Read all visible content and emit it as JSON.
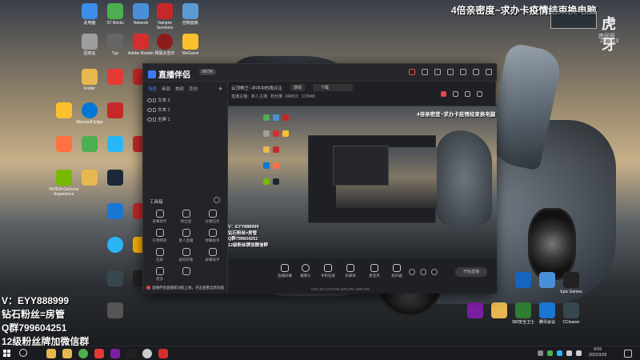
{
  "overlay": {
    "top_text": "4倍亲密度~求办卡疫情结束换电脑",
    "left_lines": [
      "V：EYY888999",
      "钻石粉丝=房管",
      "Q群799604251",
      "12级粉丝牌加微信群"
    ]
  },
  "badge": {
    "logo": "虎牙",
    "room_label": "房间号",
    "room_number": "249813"
  },
  "app": {
    "name": "直播伴侣",
    "version_label": "BETA",
    "left_tabs": [
      "场景",
      "画面",
      "美颜",
      "其他"
    ],
    "scenes": [
      "文本 2",
      "文本 1",
      "全屏 1"
    ],
    "tools_title": "工具箱",
    "tools": [
      "屏幕助手",
      "粉丝团",
      "主播任务",
      "礼物特效",
      "素人直播",
      "弹幕助手",
      "连屏",
      "虚拟形象",
      "屏幕助手",
      "更多",
      ""
    ],
    "notice": "直播伴侣直播新功能上线，点击查看全新功能",
    "room_title": "云顶棋王~冲冲冲的观点注",
    "category": "游戏",
    "game": "下载",
    "room_meta": "直播主播：新人主播",
    "stat_label1": "粉丝量",
    "stat_value1": "249813",
    "stat_value2": "172948",
    "bottom_items": [
      "直播屏幕",
      "摄像头",
      "手机投屏",
      "多媒体",
      "麦克风",
      "扬声器"
    ],
    "start_live_label": "开始直播",
    "status_text": "CPU:0%  CPU:0%  GPU:0%  GPU:0%"
  },
  "desktop_icons": [
    {
      "label": "此电脑",
      "color": "#3a8ee6"
    },
    {
      "label": "ST Bricks",
      "color": "#4caf50"
    },
    {
      "label": "Network",
      "color": "#4a90d9"
    },
    {
      "label": "Vampire Survivors",
      "color": "#c62828"
    },
    {
      "label": "控制面板",
      "color": "#5b9bd5"
    },
    {
      "label": "回收站",
      "color": "#9e9e9e"
    },
    {
      "label": "Typ",
      "color": "#666"
    },
    {
      "label": "Adobe Reader",
      "color": "#d32f2f"
    },
    {
      "label": "网易云音乐",
      "color": "#c62828"
    },
    {
      "label": "WeGame",
      "color": "#fbc02d"
    },
    {
      "label": "Microsoft Edge",
      "color": "#0078d4"
    },
    {
      "label": "Chrome",
      "color": "#4caf50"
    },
    {
      "label": "Firefox",
      "color": "#ff7043"
    },
    {
      "label": "QQ",
      "color": "#29b6f6"
    },
    {
      "label": "NVIDIA GeForce Experience",
      "color": "#76b900"
    },
    {
      "label": "Folder",
      "color": "#e6b84f"
    },
    {
      "label": "Steam",
      "color": "#1b2838"
    },
    {
      "label": "Uplay",
      "color": "#1565c0"
    },
    {
      "label": "Epic Games",
      "color": "#222"
    },
    {
      "label": "360安全卫士",
      "color": "#2e7d32"
    },
    {
      "label": "腾讯会议",
      "color": "#1976d2"
    },
    {
      "label": "CCleaner",
      "color": "#37474f"
    }
  ],
  "taskbar": {
    "time": "8:59",
    "date": "2022/3/28"
  }
}
